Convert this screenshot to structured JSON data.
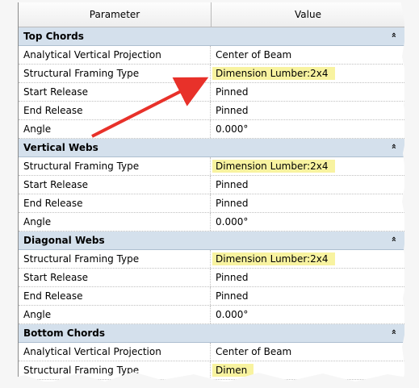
{
  "header": {
    "parameter": "Parameter",
    "value": "Value"
  },
  "collapse_glyph": "»",
  "groups": [
    {
      "title": "Top Chords",
      "rows": [
        {
          "parameter": "Analytical Vertical Projection",
          "value": "Center of Beam"
        },
        {
          "parameter": "Structural Framing Type",
          "value": "Dimension Lumber:2x4",
          "highlight": true
        },
        {
          "parameter": "Start Release",
          "value": "Pinned"
        },
        {
          "parameter": "End Release",
          "value": "Pinned"
        },
        {
          "parameter": "Angle",
          "value": "0.000°"
        }
      ]
    },
    {
      "title": "Vertical Webs",
      "rows": [
        {
          "parameter": "Structural Framing Type",
          "value": "Dimension Lumber:2x4",
          "highlight": true
        },
        {
          "parameter": "Start Release",
          "value": "Pinned"
        },
        {
          "parameter": "End Release",
          "value": "Pinned"
        },
        {
          "parameter": "Angle",
          "value": "0.000°"
        }
      ]
    },
    {
      "title": "Diagonal Webs",
      "rows": [
        {
          "parameter": "Structural Framing Type",
          "value": "Dimension Lumber:2x4",
          "highlight": true
        },
        {
          "parameter": "Start Release",
          "value": "Pinned"
        },
        {
          "parameter": "End Release",
          "value": "Pinned"
        },
        {
          "parameter": "Angle",
          "value": "0.000°"
        }
      ]
    },
    {
      "title": "Bottom Chords",
      "rows": [
        {
          "parameter": "Analytical Vertical Projection",
          "value": "Center of Beam"
        },
        {
          "parameter": "Structural Framing Type",
          "value": "Dimen",
          "highlight": true
        }
      ]
    }
  ],
  "colors": {
    "group_band": "#d4e0ec",
    "highlight": "#f8f3a0",
    "annotation_arrow": "#e8312a"
  }
}
